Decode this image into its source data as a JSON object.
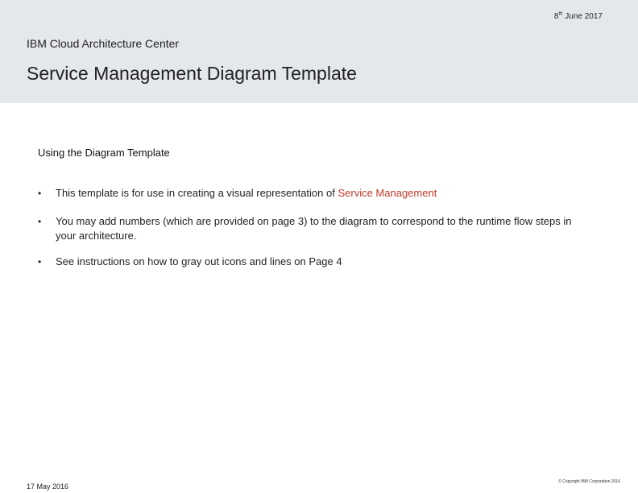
{
  "header": {
    "date_day": "8",
    "date_suffix": "th",
    "date_rest": " June 2017",
    "center_label": "IBM Cloud Architecture Center",
    "title": "Service Management Diagram Template"
  },
  "content": {
    "heading": "Using the Diagram Template",
    "bullet_symbol": "•",
    "bullets": [
      {
        "text": "This template is for use in creating a visual representation of ",
        "highlight": "Service Management"
      },
      {
        "text": "You may add numbers (which are provided on page 3) to the diagram to correspond to the runtime flow steps in your architecture."
      },
      {
        "text": "See instructions on how to gray out icons and lines on Page 4"
      }
    ]
  },
  "footer": {
    "date": "17 May 2016",
    "copyright": "© Copyright IBM Corporation 2016"
  },
  "colors": {
    "header_band": "#e4e7ec",
    "highlight_text": "#c0392b"
  }
}
